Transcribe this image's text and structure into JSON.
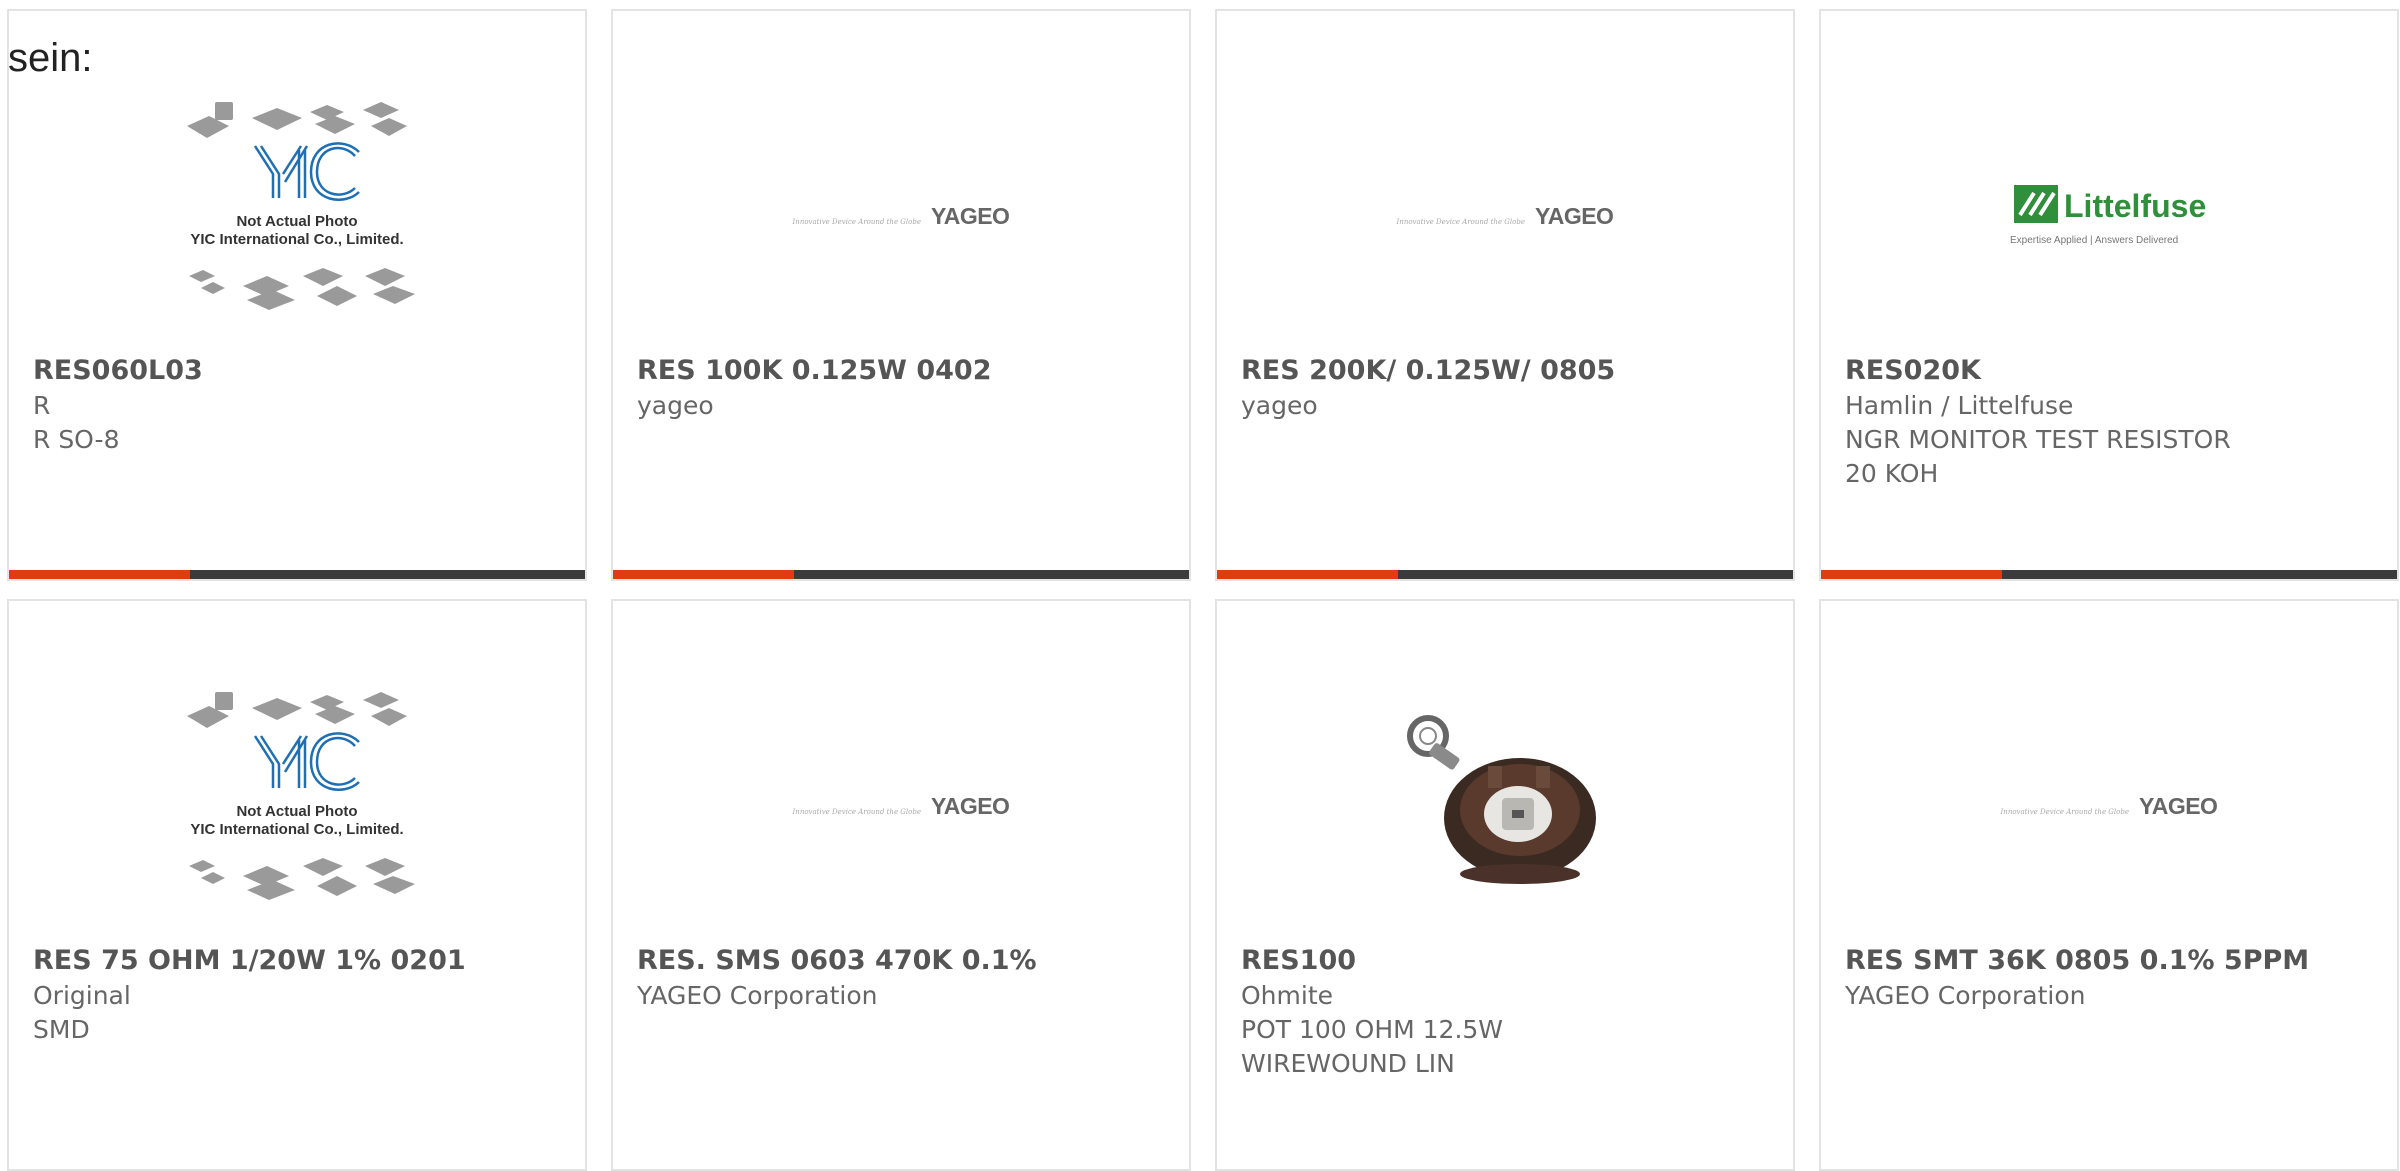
{
  "lead_text": "sein:",
  "yic_placeholder": {
    "caption_line1": "Not Actual Photo",
    "caption_line2": "YIC International Co., Limited."
  },
  "yageo_logo": {
    "tagline": "Innovative Device Around the Globe",
    "word": "YAGEO"
  },
  "littelfuse_logo": {
    "word": "Littelfuse",
    "tagline": "Expertise Applied | Answers Delivered"
  },
  "colors": {
    "accent": "#e03c12",
    "bar": "#3b3b3b",
    "border": "#e3e3e3",
    "yic_blue": "#1f6fb5",
    "littelfuse_green": "#2f8f3a"
  },
  "products": [
    {
      "name": "RES060L03",
      "lines": [
        "R",
        "R SO-8"
      ],
      "image": "yic-placeholder"
    },
    {
      "name": "RES 100K 0.125W 0402",
      "lines": [
        "yageo"
      ],
      "image": "yageo-logo"
    },
    {
      "name": "RES 200K/ 0.125W/ 0805",
      "lines": [
        "yageo"
      ],
      "image": "yageo-logo"
    },
    {
      "name": "RES020K",
      "lines": [
        "Hamlin / Littelfuse",
        "NGR MONITOR TEST RESISTOR",
        "20 KOH"
      ],
      "image": "littelfuse-logo"
    },
    {
      "name": "RES 75 OHM 1/20W 1% 0201",
      "lines": [
        "Original",
        "SMD"
      ],
      "image": "yic-placeholder"
    },
    {
      "name": "RES. SMS 0603 470K 0.1%",
      "lines": [
        "YAGEO Corporation"
      ],
      "image": "yageo-logo"
    },
    {
      "name": "RES100",
      "lines": [
        "Ohmite",
        "POT 100 OHM 12.5W",
        "WIREWOUND LIN"
      ],
      "image": "potentiometer-photo"
    },
    {
      "name": "RES SMT 36K 0805 0.1% 5PPM",
      "lines": [
        "YAGEO Corporation"
      ],
      "image": "yageo-logo"
    }
  ]
}
